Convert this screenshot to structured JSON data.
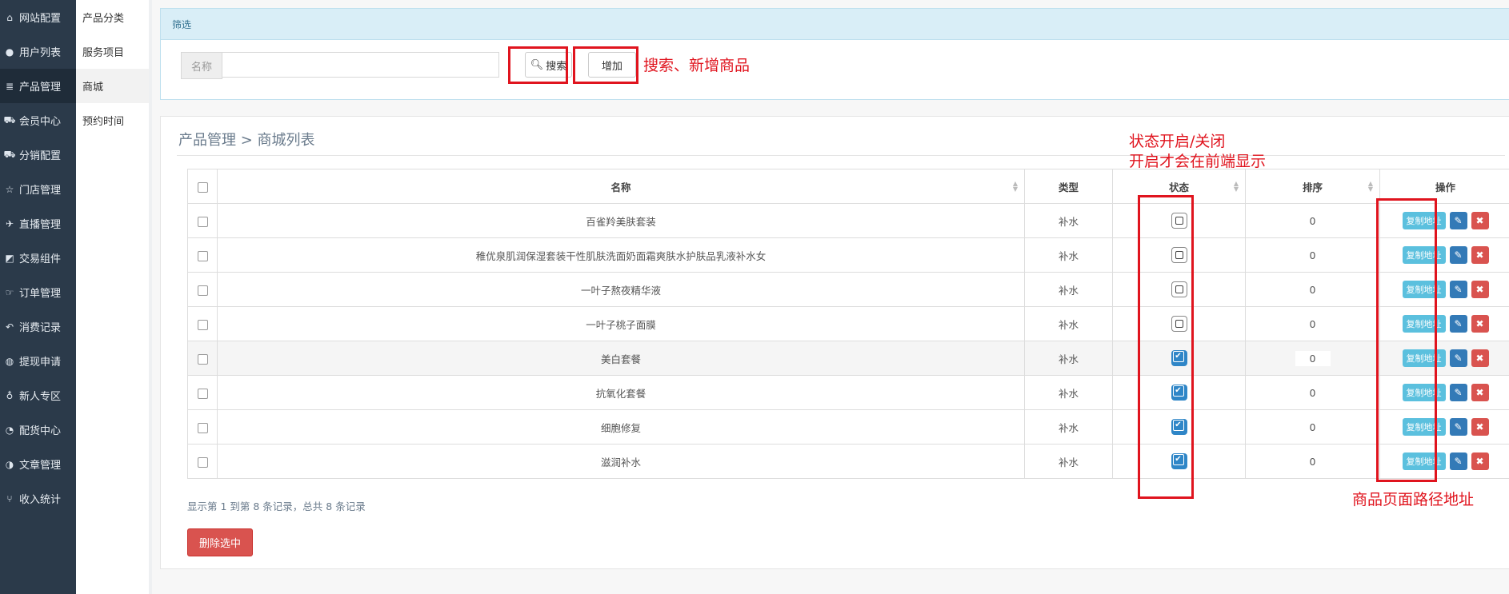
{
  "sidebar": {
    "items": [
      {
        "icon": "home-icon",
        "glyph": "⌂",
        "label": "网站配置"
      },
      {
        "icon": "user-icon",
        "glyph": "●",
        "label": "用户列表"
      },
      {
        "icon": "server-icon",
        "glyph": "≣",
        "label": "产品管理"
      },
      {
        "icon": "cart-icon",
        "glyph": "⛟",
        "label": "会员中心"
      },
      {
        "icon": "cart-icon",
        "glyph": "⛟",
        "label": "分销配置"
      },
      {
        "icon": "star-icon",
        "glyph": "☆",
        "label": "门店管理"
      },
      {
        "icon": "plane-icon",
        "glyph": "✈",
        "label": "直播管理"
      },
      {
        "icon": "eraser-icon",
        "glyph": "◩",
        "label": "交易组件"
      },
      {
        "icon": "hand-icon",
        "glyph": "☞",
        "label": "订单管理"
      },
      {
        "icon": "reply-icon",
        "glyph": "↶",
        "label": "消费记录"
      },
      {
        "icon": "wechat-icon",
        "glyph": "◍",
        "label": "提现申请"
      },
      {
        "icon": "map-pin-icon",
        "glyph": "♁",
        "label": "新人专区"
      },
      {
        "icon": "pie-chart-icon",
        "glyph": "◔",
        "label": "配货中心"
      },
      {
        "icon": "adjust-icon",
        "glyph": "◑",
        "label": "文章管理"
      },
      {
        "icon": "code-fork-icon",
        "glyph": "⑂",
        "label": "收入统计"
      }
    ]
  },
  "subnav": {
    "items": [
      {
        "label": "产品分类"
      },
      {
        "label": "服务项目"
      },
      {
        "label": "商城"
      },
      {
        "label": "预约时间"
      }
    ]
  },
  "filter": {
    "title": "筛选",
    "name_label": "名称",
    "name_value": "",
    "search_label": "搜索",
    "add_label": "增加"
  },
  "list": {
    "breadcrumb": "产品管理 > 商城列表",
    "headers": {
      "name": "名称",
      "type": "类型",
      "status": "状态",
      "sort": "排序",
      "ops": "操作"
    },
    "rows": [
      {
        "name": "百雀羚美肤套装",
        "type": "补水",
        "status": false,
        "sort": "0"
      },
      {
        "name": "稚优泉肌润保湿套装干性肌肤洗面奶面霜爽肤水护肤品乳液补水女",
        "type": "补水",
        "status": false,
        "sort": "0"
      },
      {
        "name": "一叶子熬夜精华液",
        "type": "补水",
        "status": false,
        "sort": "0"
      },
      {
        "name": "一叶子桃子面膜",
        "type": "补水",
        "status": false,
        "sort": "0"
      },
      {
        "name": "美白套餐",
        "type": "补水",
        "status": true,
        "sort": "0"
      },
      {
        "name": "抗氧化套餐",
        "type": "补水",
        "status": true,
        "sort": "0"
      },
      {
        "name": "细胞修复",
        "type": "补水",
        "status": true,
        "sort": "0"
      },
      {
        "name": "滋润补水",
        "type": "补水",
        "status": true,
        "sort": "0"
      }
    ],
    "copy_label": "复制地址",
    "summary": "显示第 1 到第 8 条记录，总共 8 条记录",
    "delete_selected": "删除选中"
  },
  "annotations": {
    "search_add": "搜索、新增商品",
    "status_line1": "状态开启/关闭",
    "status_line2": "开启才会在前端显示",
    "path": "商品页面路径地址"
  },
  "colors": {
    "annotation": "#e0141e",
    "sidebar": "#2b3a4a",
    "switch_on": "#2f86c7"
  }
}
